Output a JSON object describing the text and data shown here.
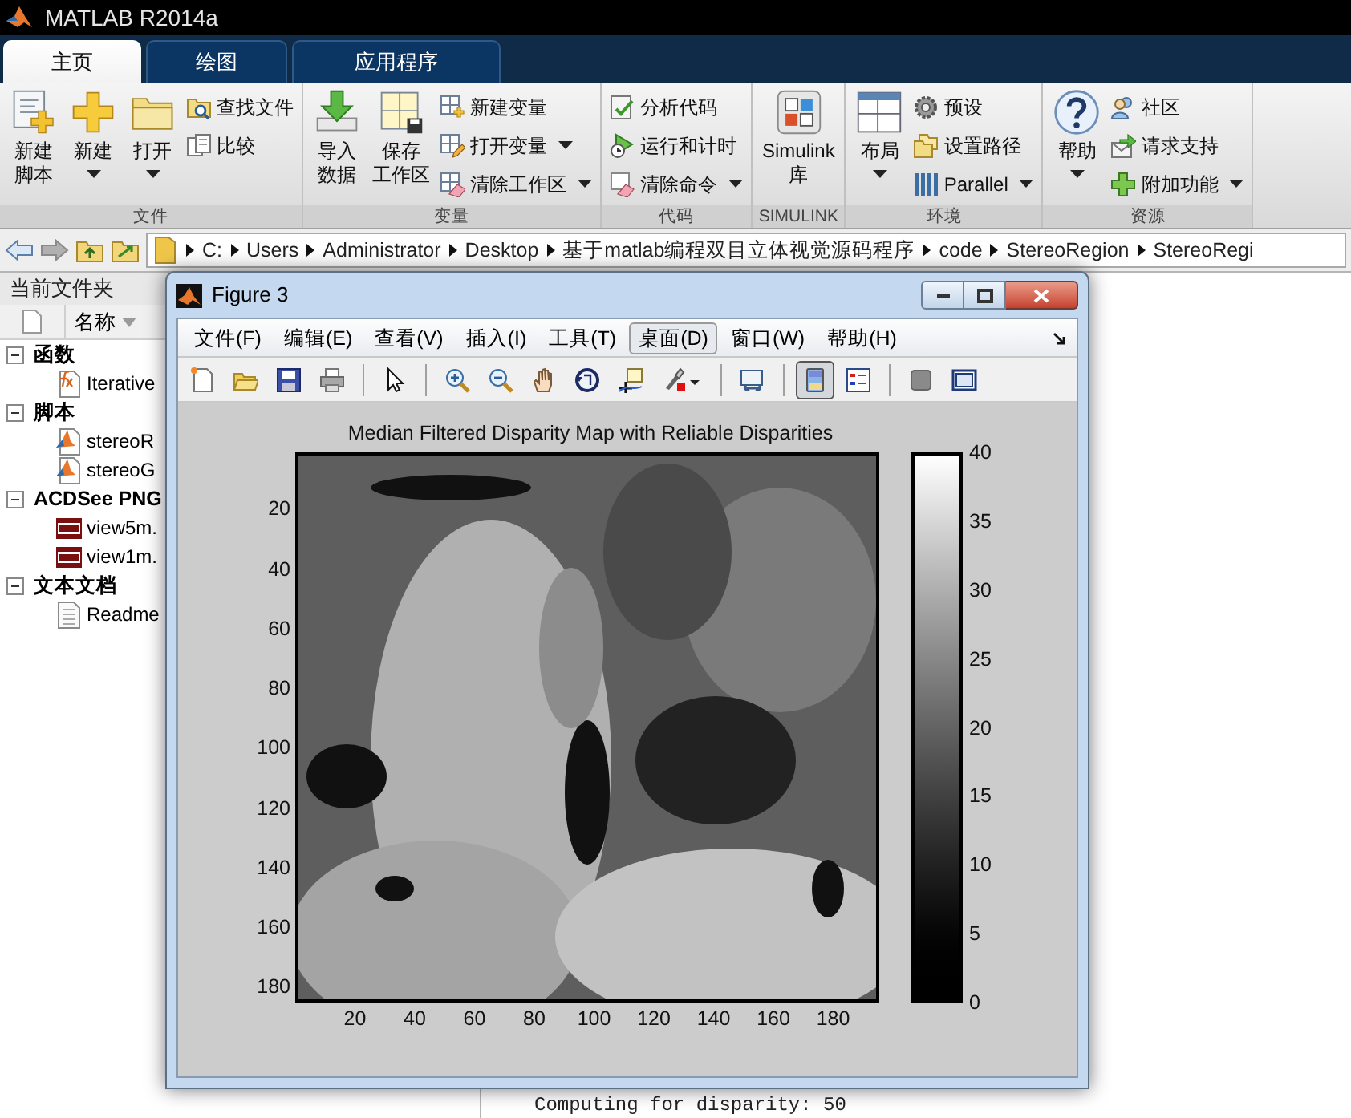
{
  "window": {
    "title": "MATLAB R2014a"
  },
  "tabs": [
    {
      "label": "主页",
      "selected": true
    },
    {
      "label": "绘图",
      "selected": false
    },
    {
      "label": "应用程序",
      "selected": false
    }
  ],
  "toolstrip": {
    "sections": [
      {
        "title": "文件",
        "items": [
          {
            "kind": "large",
            "lines": [
              "新建",
              "脚本"
            ],
            "dropdown": false
          },
          {
            "kind": "large",
            "lines": [
              "新建"
            ],
            "dropdown": true
          },
          {
            "kind": "large",
            "lines": [
              "打开"
            ],
            "dropdown": true
          },
          {
            "kind": "column",
            "items": [
              {
                "label": "查找文件",
                "dropdown": false
              },
              {
                "label": "比较",
                "dropdown": false
              }
            ]
          }
        ]
      },
      {
        "title": "变量",
        "items": [
          {
            "kind": "large",
            "lines": [
              "导入",
              "数据"
            ],
            "dropdown": false
          },
          {
            "kind": "large",
            "lines": [
              "保存",
              "工作区"
            ],
            "dropdown": false
          },
          {
            "kind": "column",
            "items": [
              {
                "label": "新建变量",
                "dropdown": false
              },
              {
                "label": "打开变量",
                "dropdown": true
              },
              {
                "label": "清除工作区",
                "dropdown": true
              }
            ]
          }
        ]
      },
      {
        "title": "代码",
        "items": [
          {
            "kind": "column",
            "items": [
              {
                "label": "分析代码",
                "dropdown": false
              },
              {
                "label": "运行和计时",
                "dropdown": false
              },
              {
                "label": "清除命令",
                "dropdown": true
              }
            ]
          }
        ]
      },
      {
        "title": "SIMULINK",
        "items": [
          {
            "kind": "large",
            "lines": [
              "Simulink",
              "库"
            ],
            "dropdown": false
          }
        ]
      },
      {
        "title": "环境",
        "items": [
          {
            "kind": "large",
            "lines": [
              "布局"
            ],
            "dropdown": true
          },
          {
            "kind": "column",
            "items": [
              {
                "label": "预设",
                "dropdown": false
              },
              {
                "label": "设置路径",
                "dropdown": false
              },
              {
                "label": "Parallel",
                "dropdown": true
              }
            ]
          }
        ]
      },
      {
        "title": "资源",
        "items": [
          {
            "kind": "large",
            "lines": [
              "帮助"
            ],
            "dropdown": true
          },
          {
            "kind": "column",
            "items": [
              {
                "label": "社区",
                "dropdown": false
              },
              {
                "label": "请求支持",
                "dropdown": false
              },
              {
                "label": "附加功能",
                "dropdown": true
              }
            ]
          }
        ]
      }
    ]
  },
  "address_bar": {
    "path": [
      "C:",
      "Users",
      "Administrator",
      "Desktop",
      "基于matlab编程双目立体视觉源码程序",
      "code",
      "StereoRegion",
      "StereoRegi"
    ]
  },
  "current_folder": {
    "title": "当前文件夹",
    "column": "名称",
    "groups": [
      {
        "label": "函数",
        "expanded": true,
        "children": [
          {
            "kind": "function",
            "label": "Iterative"
          }
        ]
      },
      {
        "label": "脚本",
        "expanded": true,
        "children": [
          {
            "kind": "script",
            "label": "stereoR"
          },
          {
            "kind": "script",
            "label": "stereoG"
          }
        ]
      },
      {
        "label": "ACDSee PNG",
        "expanded": true,
        "children": [
          {
            "kind": "png",
            "label": "view5m."
          },
          {
            "kind": "png",
            "label": "view1m."
          }
        ]
      },
      {
        "label": "文本文档",
        "expanded": true,
        "children": [
          {
            "kind": "text",
            "label": "Readme"
          }
        ]
      }
    ]
  },
  "command_window": {
    "lines": [
      "Computing for disparity: 50"
    ]
  },
  "figure": {
    "title": "Figure 3",
    "menu": [
      {
        "label": "文件(F)",
        "selected": false
      },
      {
        "label": "编辑(E)",
        "selected": false
      },
      {
        "label": "查看(V)",
        "selected": false
      },
      {
        "label": "插入(I)",
        "selected": false
      },
      {
        "label": "工具(T)",
        "selected": false
      },
      {
        "label": "桌面(D)",
        "selected": true
      },
      {
        "label": "窗口(W)",
        "selected": false
      },
      {
        "label": "帮助(H)",
        "selected": false
      }
    ],
    "toolbar": [
      {
        "kind": "button",
        "pressed": false
      },
      {
        "kind": "button",
        "pressed": false
      },
      {
        "kind": "button",
        "pressed": false
      },
      {
        "kind": "button",
        "pressed": false
      },
      {
        "kind": "separator"
      },
      {
        "kind": "button",
        "pressed": false
      },
      {
        "kind": "separator"
      },
      {
        "kind": "button",
        "pressed": false
      },
      {
        "kind": "button",
        "pressed": false
      },
      {
        "kind": "button",
        "pressed": false
      },
      {
        "kind": "button",
        "pressed": false
      },
      {
        "kind": "button",
        "pressed": false
      },
      {
        "kind": "button",
        "pressed": false
      },
      {
        "kind": "separator"
      },
      {
        "kind": "button",
        "pressed": false
      },
      {
        "kind": "separator"
      },
      {
        "kind": "button",
        "pressed": true
      },
      {
        "kind": "button",
        "pressed": false
      },
      {
        "kind": "separator"
      },
      {
        "kind": "button",
        "pressed": false
      },
      {
        "kind": "button",
        "pressed": false
      }
    ],
    "axes": {
      "title": "Median Filtered Disparity Map with Reliable Disparities",
      "xticks": [
        "20",
        "40",
        "60",
        "80",
        "100",
        "120",
        "140",
        "160",
        "180"
      ],
      "yticks": [
        "20",
        "40",
        "60",
        "80",
        "100",
        "120",
        "140",
        "160",
        "180"
      ]
    },
    "colorbar": {
      "ticks": [
        "40",
        "35",
        "30",
        "25",
        "20",
        "15",
        "10",
        "5",
        "0"
      ]
    }
  }
}
